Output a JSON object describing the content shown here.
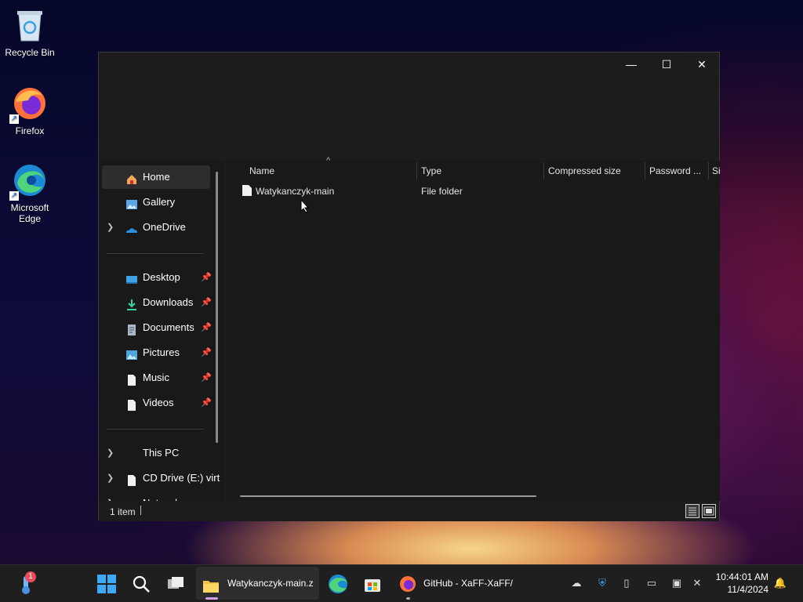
{
  "desktop": {
    "icons": [
      {
        "label": "Recycle Bin"
      },
      {
        "label": "Firefox"
      },
      {
        "label": "Microsoft Edge"
      }
    ]
  },
  "window": {
    "controls": {
      "minimize": "—",
      "maximize": "☐",
      "close": "✕"
    },
    "sort_indicator": "^",
    "columns": [
      "Name",
      "Type",
      "Compressed size",
      "Password ...",
      "Si"
    ],
    "rows": [
      {
        "name": "Watykanczyk-main",
        "type": "File folder"
      }
    ],
    "status_text": "1 item"
  },
  "navigation": {
    "items": [
      {
        "label": "Home"
      },
      {
        "label": "Gallery"
      },
      {
        "label": "OneDrive"
      },
      {
        "label": "Desktop"
      },
      {
        "label": "Downloads"
      },
      {
        "label": "Documents"
      },
      {
        "label": "Pictures"
      },
      {
        "label": "Music"
      },
      {
        "label": "Videos"
      },
      {
        "label": "This PC"
      },
      {
        "label": "CD Drive (E:) virt"
      },
      {
        "label": "Network"
      }
    ]
  },
  "taskbar": {
    "widgets_badge": "1",
    "apps": [
      {
        "label": "Watykanczyk-main.z"
      },
      {
        "label": "GitHub - XaFF-XaFF/"
      }
    ],
    "clock": {
      "time": "10:44:01 AM",
      "date": "11/4/2024"
    }
  },
  "colors": {
    "accent": "#4cc2ff",
    "folder_yellow": "#f6c445",
    "window_bg": "#1c1c1c",
    "taskbar_bg": "#1f1f1f"
  }
}
